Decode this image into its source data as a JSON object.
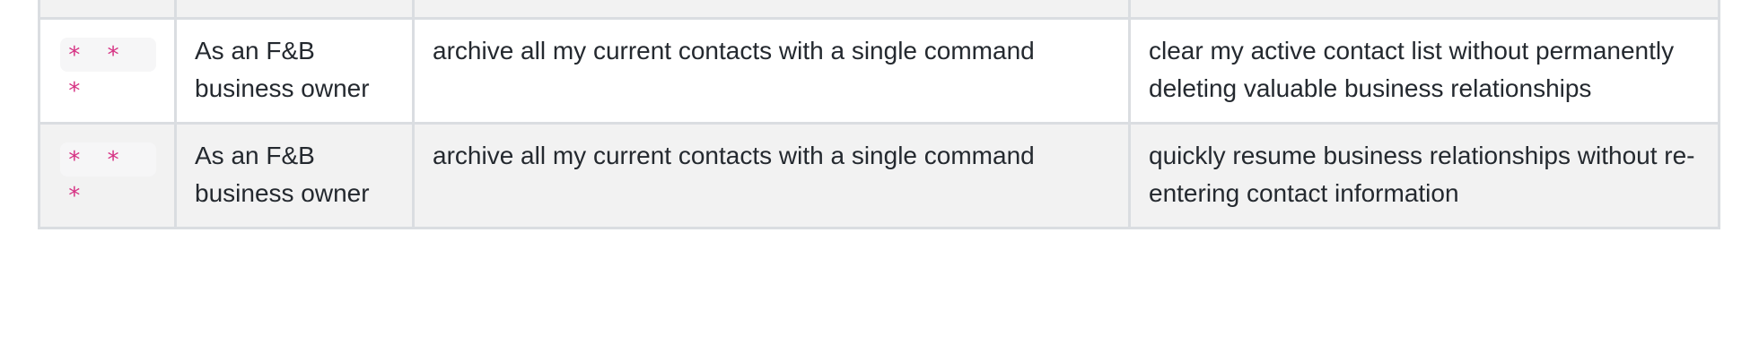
{
  "table": {
    "rows": [
      {
        "priority": "* * *",
        "as_a": "As an F&B business owner",
        "i_want_to": "archive all my current contacts with a single command",
        "so_that": "clear my active contact list without permanently deleting valuable business relationships"
      },
      {
        "priority": "* * *",
        "as_a": "As an F&B business owner",
        "i_want_to": "archive all my current contacts with a single command",
        "so_that": "quickly resume business relationships without re-entering contact information"
      }
    ]
  },
  "colors": {
    "priority_text": "#d63384",
    "stripe_background": "#f2f2f2",
    "border": "#dadde1"
  }
}
